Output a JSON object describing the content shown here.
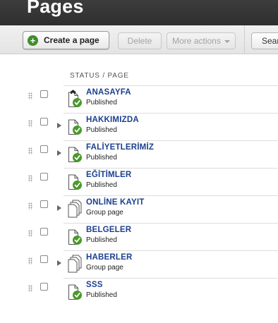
{
  "header": {
    "title": "Pages"
  },
  "toolbar": {
    "create_label": "Create a page",
    "create_icon": "plus-icon",
    "delete_label": "Delete",
    "more_actions_label": "More actions",
    "search_label": "Sear"
  },
  "table": {
    "column_header": "STATUS / PAGE",
    "rows": [
      {
        "title": "ANASAYFA",
        "status": "Published",
        "type": "home",
        "expandable": false
      },
      {
        "title": "HAKKIMIZDA",
        "status": "Published",
        "type": "page",
        "expandable": true
      },
      {
        "title": "FALİYETLERİMİZ",
        "status": "Published",
        "type": "page",
        "expandable": true
      },
      {
        "title": "EĞİTİMLER",
        "status": "Published",
        "type": "page",
        "expandable": false
      },
      {
        "title": "ONLİNE KAYIT",
        "status": "Group page",
        "type": "group",
        "expandable": true
      },
      {
        "title": "BELGELER",
        "status": "Published",
        "type": "page",
        "expandable": false
      },
      {
        "title": "HABERLER",
        "status": "Group page",
        "type": "group",
        "expandable": true
      },
      {
        "title": "SSS",
        "status": "Published",
        "type": "page",
        "expandable": false
      }
    ]
  },
  "colors": {
    "header_bg": "#333333",
    "link": "#1b3f8f",
    "published_check": "#4a9a2a",
    "create_plus": "#3f8f2a"
  }
}
